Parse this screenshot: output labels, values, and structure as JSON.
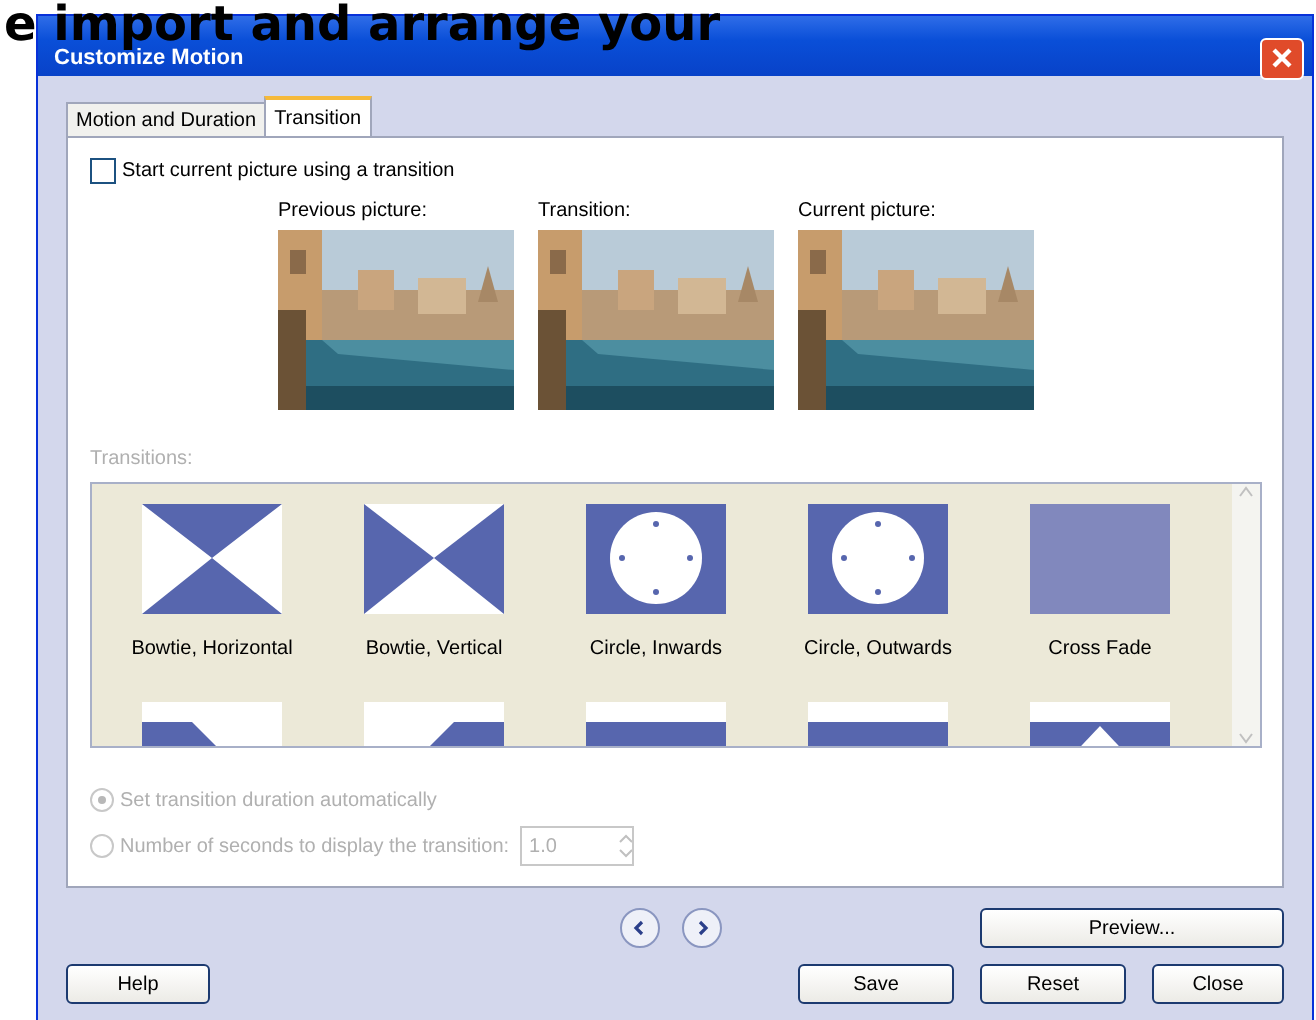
{
  "background_text": "e import and arrange your",
  "window": {
    "title": "Customize Motion"
  },
  "tabs": [
    {
      "label": "Motion and Duration",
      "selected": false
    },
    {
      "label": "Transition",
      "selected": true
    }
  ],
  "start_checkbox": {
    "label": "Start current picture using a transition",
    "checked": false
  },
  "previews": [
    {
      "label": "Previous picture:",
      "kind": "picture"
    },
    {
      "label": "Transition:",
      "kind": "picture"
    },
    {
      "label": "Current picture:",
      "kind": "picture"
    }
  ],
  "transitions_section": {
    "label": "Transitions:",
    "disabled": true
  },
  "transitions": [
    {
      "label": "Bowtie, Horizontal",
      "kind": "bowtie-h"
    },
    {
      "label": "Bowtie, Vertical",
      "kind": "bowtie-v"
    },
    {
      "label": "Circle, Inwards",
      "kind": "circle"
    },
    {
      "label": "Circle, Outwards",
      "kind": "circle"
    },
    {
      "label": "Cross Fade",
      "kind": "fade"
    },
    {
      "kind": "corner-left"
    },
    {
      "kind": "corner-right"
    },
    {
      "kind": "band"
    },
    {
      "kind": "band"
    },
    {
      "kind": "peak"
    }
  ],
  "duration_options": [
    {
      "label": "Set transition duration automatically",
      "selected": true,
      "disabled": true
    },
    {
      "label": "Number of seconds to display the transition:",
      "selected": false,
      "disabled": true
    }
  ],
  "seconds_field": {
    "value": "1.0",
    "disabled": true
  },
  "buttons": [
    {
      "label": "Preview...",
      "kind": "preview"
    },
    {
      "label": "Help",
      "kind": "help"
    },
    {
      "label": "Save",
      "kind": "save"
    },
    {
      "label": "Reset",
      "kind": "reset"
    },
    {
      "label": "Close",
      "kind": "close"
    }
  ]
}
